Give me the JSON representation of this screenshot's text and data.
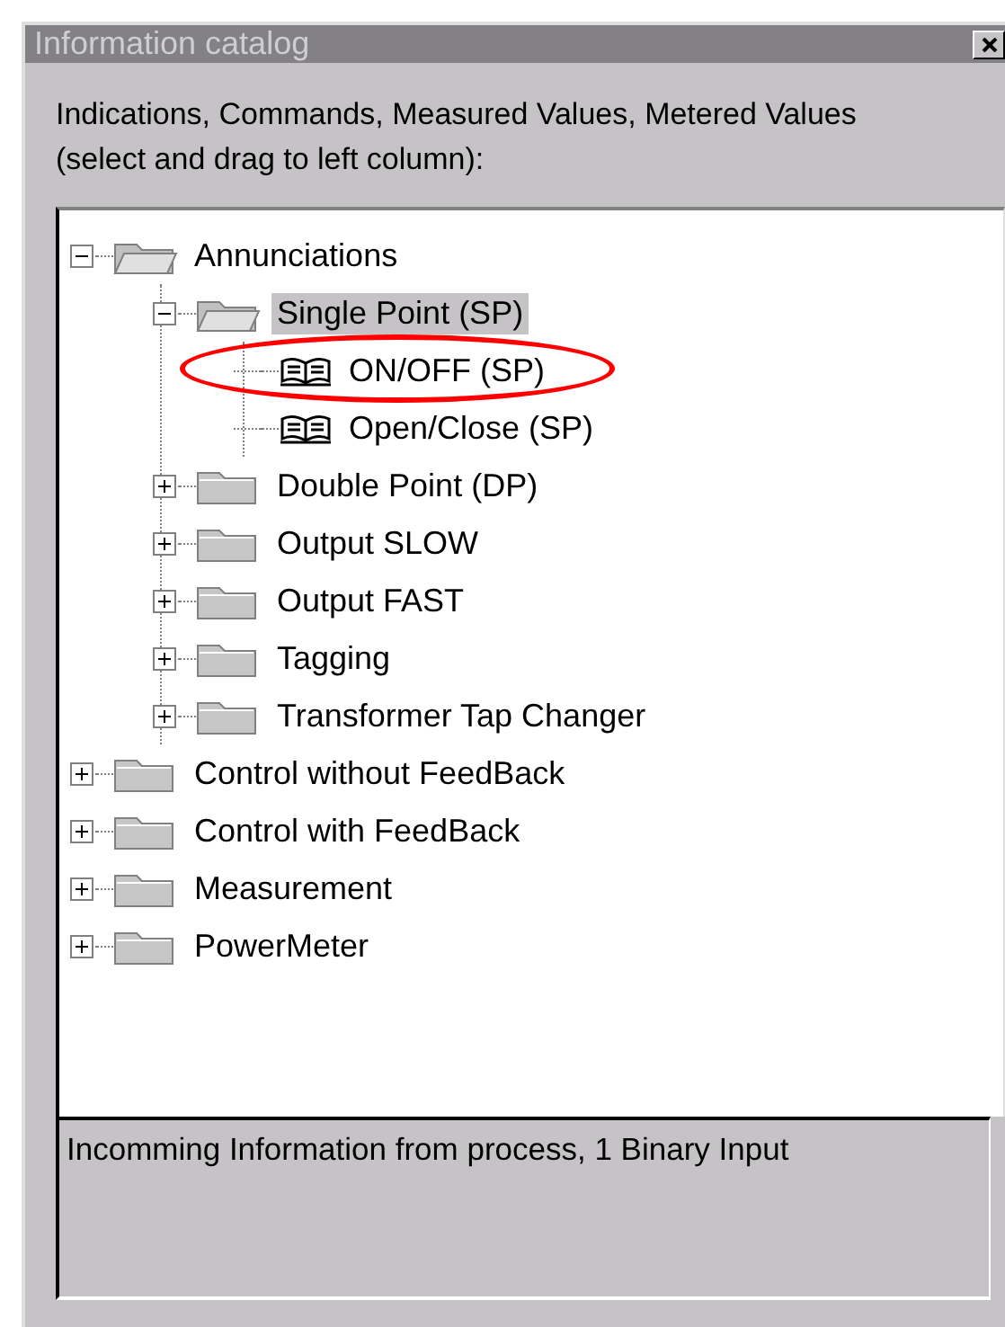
{
  "window": {
    "title": "Information catalog"
  },
  "instruction": "Indications, Commands, Measured Values, Metered Values (select and drag to left column):",
  "tree": [
    {
      "label": "Annunciations",
      "kind": "folder",
      "expanded": true,
      "selected": false,
      "circled": false,
      "children": [
        {
          "label": "Single Point (SP)",
          "kind": "folder",
          "expanded": true,
          "selected": true,
          "circled": false,
          "children": [
            {
              "label": "ON/OFF (SP)",
              "kind": "item",
              "selected": false,
              "circled": true
            },
            {
              "label": "Open/Close (SP)",
              "kind": "item",
              "selected": false,
              "circled": false
            }
          ]
        },
        {
          "label": "Double Point (DP)",
          "kind": "folder",
          "expanded": false,
          "selected": false,
          "circled": false
        },
        {
          "label": "Output SLOW",
          "kind": "folder",
          "expanded": false,
          "selected": false,
          "circled": false
        },
        {
          "label": "Output FAST",
          "kind": "folder",
          "expanded": false,
          "selected": false,
          "circled": false
        },
        {
          "label": "Tagging",
          "kind": "folder",
          "expanded": false,
          "selected": false,
          "circled": false
        },
        {
          "label": "Transformer Tap Changer",
          "kind": "folder",
          "expanded": false,
          "selected": false,
          "circled": false
        }
      ]
    },
    {
      "label": "Control without FeedBack",
      "kind": "folder",
      "expanded": false,
      "selected": false,
      "circled": false
    },
    {
      "label": "Control with FeedBack",
      "kind": "folder",
      "expanded": false,
      "selected": false,
      "circled": false
    },
    {
      "label": "Measurement",
      "kind": "folder",
      "expanded": false,
      "selected": false,
      "circled": false
    },
    {
      "label": "PowerMeter",
      "kind": "folder",
      "expanded": false,
      "selected": false,
      "circled": false
    }
  ],
  "description": "Incomming Information from process, 1 Binary Input"
}
